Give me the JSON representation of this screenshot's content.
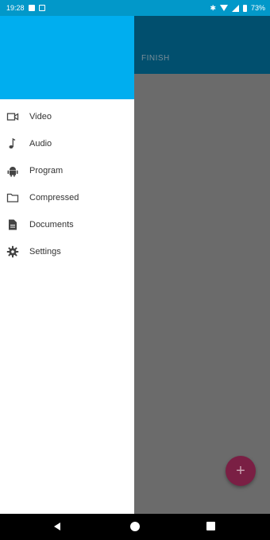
{
  "status_bar": {
    "time": "19:28",
    "battery_text": "73%"
  },
  "app": {
    "tab_label": "FINISH",
    "fab_icon": "+"
  },
  "drawer": {
    "items": [
      {
        "label": "Video",
        "icon": "video-camera-icon"
      },
      {
        "label": "Audio",
        "icon": "music-note-icon"
      },
      {
        "label": "Program",
        "icon": "android-icon"
      },
      {
        "label": "Compressed",
        "icon": "folder-icon"
      },
      {
        "label": "Documents",
        "icon": "document-icon"
      },
      {
        "label": "Settings",
        "icon": "gear-icon"
      }
    ]
  },
  "colors": {
    "status_bar": "#0298c9",
    "drawer_header": "#00aeef",
    "toolbar": "#014f6e",
    "fab": "#7a1f44"
  }
}
